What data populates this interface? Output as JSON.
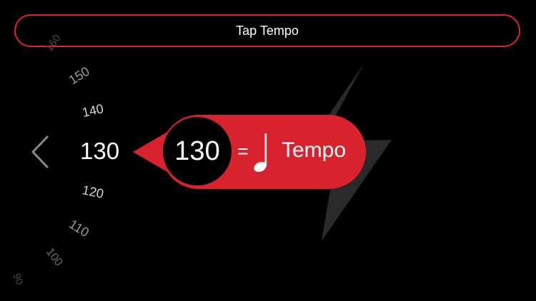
{
  "header": {
    "tap_tempo_label": "Tap Tempo"
  },
  "dial": {
    "current": "130",
    "labels": [
      "160",
      "150",
      "140",
      "120",
      "110",
      "100",
      "90"
    ]
  },
  "tempo_display": {
    "value": "130",
    "equals": "=",
    "unit_label": "Tempo"
  },
  "icons": {
    "back": "chevron-left-icon",
    "note": "quarter-note-icon",
    "background": "lightning-bolt-icon"
  },
  "colors": {
    "accent": "#d8232e",
    "background": "#000000",
    "text": "#ffffff",
    "dial_text": "#bdbdbd",
    "bolt": "#2a2a2a"
  }
}
